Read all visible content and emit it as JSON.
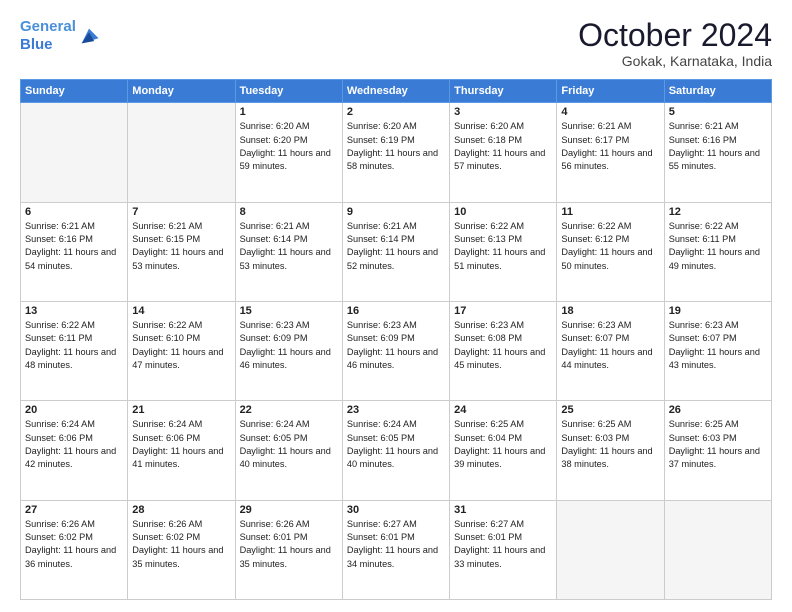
{
  "header": {
    "logo_line1": "General",
    "logo_line2": "Blue",
    "title": "October 2024",
    "subtitle": "Gokak, Karnataka, India"
  },
  "weekdays": [
    "Sunday",
    "Monday",
    "Tuesday",
    "Wednesday",
    "Thursday",
    "Friday",
    "Saturday"
  ],
  "weeks": [
    [
      {
        "day": "",
        "info": ""
      },
      {
        "day": "",
        "info": ""
      },
      {
        "day": "1",
        "info": "Sunrise: 6:20 AM\nSunset: 6:20 PM\nDaylight: 11 hours and 59 minutes."
      },
      {
        "day": "2",
        "info": "Sunrise: 6:20 AM\nSunset: 6:19 PM\nDaylight: 11 hours and 58 minutes."
      },
      {
        "day": "3",
        "info": "Sunrise: 6:20 AM\nSunset: 6:18 PM\nDaylight: 11 hours and 57 minutes."
      },
      {
        "day": "4",
        "info": "Sunrise: 6:21 AM\nSunset: 6:17 PM\nDaylight: 11 hours and 56 minutes."
      },
      {
        "day": "5",
        "info": "Sunrise: 6:21 AM\nSunset: 6:16 PM\nDaylight: 11 hours and 55 minutes."
      }
    ],
    [
      {
        "day": "6",
        "info": "Sunrise: 6:21 AM\nSunset: 6:16 PM\nDaylight: 11 hours and 54 minutes."
      },
      {
        "day": "7",
        "info": "Sunrise: 6:21 AM\nSunset: 6:15 PM\nDaylight: 11 hours and 53 minutes."
      },
      {
        "day": "8",
        "info": "Sunrise: 6:21 AM\nSunset: 6:14 PM\nDaylight: 11 hours and 53 minutes."
      },
      {
        "day": "9",
        "info": "Sunrise: 6:21 AM\nSunset: 6:14 PM\nDaylight: 11 hours and 52 minutes."
      },
      {
        "day": "10",
        "info": "Sunrise: 6:22 AM\nSunset: 6:13 PM\nDaylight: 11 hours and 51 minutes."
      },
      {
        "day": "11",
        "info": "Sunrise: 6:22 AM\nSunset: 6:12 PM\nDaylight: 11 hours and 50 minutes."
      },
      {
        "day": "12",
        "info": "Sunrise: 6:22 AM\nSunset: 6:11 PM\nDaylight: 11 hours and 49 minutes."
      }
    ],
    [
      {
        "day": "13",
        "info": "Sunrise: 6:22 AM\nSunset: 6:11 PM\nDaylight: 11 hours and 48 minutes."
      },
      {
        "day": "14",
        "info": "Sunrise: 6:22 AM\nSunset: 6:10 PM\nDaylight: 11 hours and 47 minutes."
      },
      {
        "day": "15",
        "info": "Sunrise: 6:23 AM\nSunset: 6:09 PM\nDaylight: 11 hours and 46 minutes."
      },
      {
        "day": "16",
        "info": "Sunrise: 6:23 AM\nSunset: 6:09 PM\nDaylight: 11 hours and 46 minutes."
      },
      {
        "day": "17",
        "info": "Sunrise: 6:23 AM\nSunset: 6:08 PM\nDaylight: 11 hours and 45 minutes."
      },
      {
        "day": "18",
        "info": "Sunrise: 6:23 AM\nSunset: 6:07 PM\nDaylight: 11 hours and 44 minutes."
      },
      {
        "day": "19",
        "info": "Sunrise: 6:23 AM\nSunset: 6:07 PM\nDaylight: 11 hours and 43 minutes."
      }
    ],
    [
      {
        "day": "20",
        "info": "Sunrise: 6:24 AM\nSunset: 6:06 PM\nDaylight: 11 hours and 42 minutes."
      },
      {
        "day": "21",
        "info": "Sunrise: 6:24 AM\nSunset: 6:06 PM\nDaylight: 11 hours and 41 minutes."
      },
      {
        "day": "22",
        "info": "Sunrise: 6:24 AM\nSunset: 6:05 PM\nDaylight: 11 hours and 40 minutes."
      },
      {
        "day": "23",
        "info": "Sunrise: 6:24 AM\nSunset: 6:05 PM\nDaylight: 11 hours and 40 minutes."
      },
      {
        "day": "24",
        "info": "Sunrise: 6:25 AM\nSunset: 6:04 PM\nDaylight: 11 hours and 39 minutes."
      },
      {
        "day": "25",
        "info": "Sunrise: 6:25 AM\nSunset: 6:03 PM\nDaylight: 11 hours and 38 minutes."
      },
      {
        "day": "26",
        "info": "Sunrise: 6:25 AM\nSunset: 6:03 PM\nDaylight: 11 hours and 37 minutes."
      }
    ],
    [
      {
        "day": "27",
        "info": "Sunrise: 6:26 AM\nSunset: 6:02 PM\nDaylight: 11 hours and 36 minutes."
      },
      {
        "day": "28",
        "info": "Sunrise: 6:26 AM\nSunset: 6:02 PM\nDaylight: 11 hours and 35 minutes."
      },
      {
        "day": "29",
        "info": "Sunrise: 6:26 AM\nSunset: 6:01 PM\nDaylight: 11 hours and 35 minutes."
      },
      {
        "day": "30",
        "info": "Sunrise: 6:27 AM\nSunset: 6:01 PM\nDaylight: 11 hours and 34 minutes."
      },
      {
        "day": "31",
        "info": "Sunrise: 6:27 AM\nSunset: 6:01 PM\nDaylight: 11 hours and 33 minutes."
      },
      {
        "day": "",
        "info": ""
      },
      {
        "day": "",
        "info": ""
      }
    ]
  ]
}
